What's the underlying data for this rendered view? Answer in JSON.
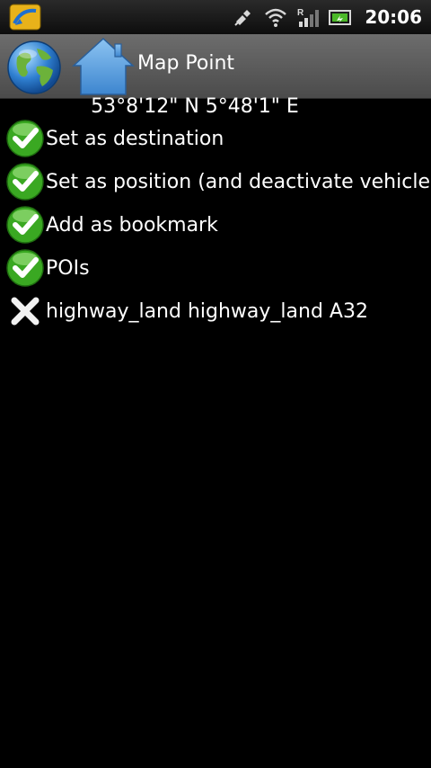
{
  "status_bar": {
    "time": "20:06",
    "icons": [
      "app-notification-icon",
      "gps-icon",
      "wifi-icon",
      "signal-icon",
      "battery-icon"
    ]
  },
  "header": {
    "title": "Map Point",
    "buttons": [
      "globe-icon",
      "home-icon"
    ]
  },
  "coordinates": "53°8'12\" N 5°48'1\" E",
  "menu": {
    "items": [
      {
        "label": "Set as destination",
        "icon": "check-icon"
      },
      {
        "label": "Set as position (and deactivate vehicle)",
        "icon": "check-icon"
      },
      {
        "label": "Add as bookmark",
        "icon": "check-icon"
      },
      {
        "label": "POIs",
        "icon": "check-icon"
      },
      {
        "label": "highway_land highway_land A32",
        "icon": "close-icon"
      }
    ]
  },
  "colors": {
    "background": "#000000",
    "titlebar": "#5c5c5c",
    "check_green": "#3aa822"
  }
}
